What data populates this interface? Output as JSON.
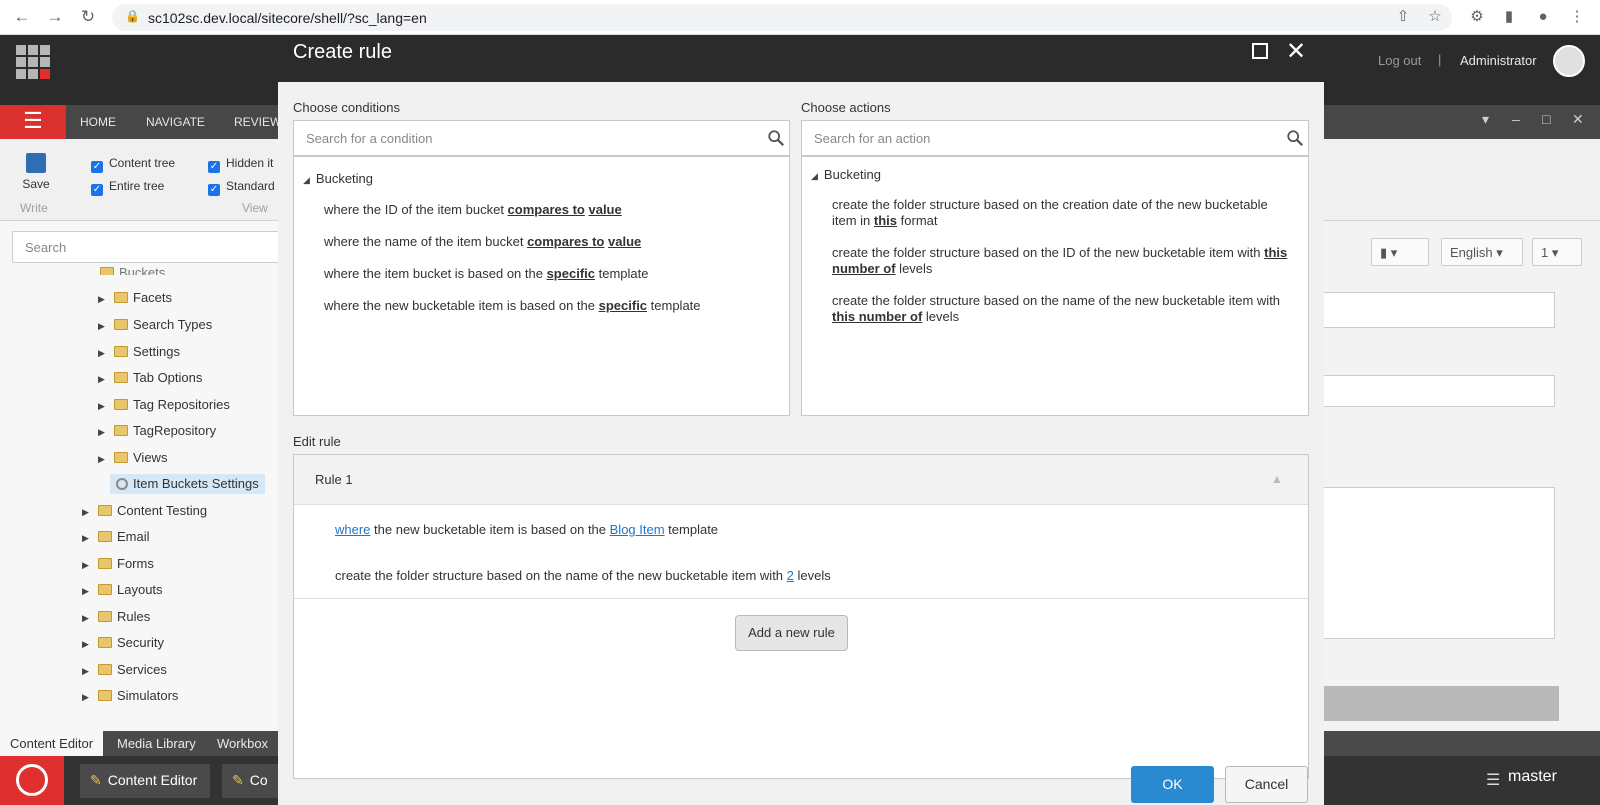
{
  "browser": {
    "url": "sc102sc.dev.local/sitecore/shell/?sc_lang=en"
  },
  "header": {
    "logout": "Log out",
    "separator": "|",
    "user": "Administrator"
  },
  "ribbon": {
    "tabs": [
      "HOME",
      "NAVIGATE",
      "REVIEW"
    ],
    "save_label": "Save",
    "write_group": "Write",
    "view_group": "View",
    "checkboxes": [
      "Content tree",
      "Entire tree",
      "Hidden it",
      "Standard"
    ]
  },
  "tree": {
    "search_placeholder": "Search",
    "partial_top": "Buckets",
    "items": [
      {
        "label": "Facets",
        "level": 2
      },
      {
        "label": "Search Types",
        "level": 2
      },
      {
        "label": "Settings",
        "level": 2
      },
      {
        "label": "Tab Options",
        "level": 2
      },
      {
        "label": "Tag Repositories",
        "level": 2
      },
      {
        "label": "TagRepository",
        "level": 2
      },
      {
        "label": "Views",
        "level": 2
      },
      {
        "label": "Item Buckets Settings",
        "level": 2,
        "selected": true
      },
      {
        "label": "Content Testing",
        "level": 1
      },
      {
        "label": "Email",
        "level": 1
      },
      {
        "label": "Forms",
        "level": 1
      },
      {
        "label": "Layouts",
        "level": 1
      },
      {
        "label": "Rules",
        "level": 1
      },
      {
        "label": "Security",
        "level": 1
      },
      {
        "label": "Services",
        "level": 1
      },
      {
        "label": "Simulators",
        "level": 1
      }
    ]
  },
  "bottom_tabs": [
    "Content Editor",
    "Media Library",
    "Workbox"
  ],
  "taskbar": {
    "tasks": [
      "Content Editor",
      "Co"
    ],
    "database": "master"
  },
  "right_pane": {
    "language": "English",
    "version": "1"
  },
  "dialog": {
    "title": "Create rule",
    "conditions": {
      "label": "Choose conditions",
      "search_placeholder": "Search for a condition",
      "group": "Bucketing",
      "items": [
        [
          {
            "t": "where the ID of the item bucket "
          },
          {
            "k": "compares to"
          },
          {
            "t": " "
          },
          {
            "k": "value"
          }
        ],
        [
          {
            "t": "where the name of the item bucket "
          },
          {
            "k": "compares to"
          },
          {
            "t": " "
          },
          {
            "k": "value"
          }
        ],
        [
          {
            "t": "where the item bucket is based on the "
          },
          {
            "k": "specific"
          },
          {
            "t": " template"
          }
        ],
        [
          {
            "t": "where the new bucketable item is based on the "
          },
          {
            "k": "specific"
          },
          {
            "t": " template"
          }
        ]
      ]
    },
    "actions": {
      "label": "Choose actions",
      "search_placeholder": "Search for an action",
      "group": "Bucketing",
      "items": [
        [
          {
            "t": "create the folder structure based on the creation date of the new bucketable item in "
          },
          {
            "k": "this"
          },
          {
            "t": " format"
          }
        ],
        [
          {
            "t": "create the folder structure based on the ID of the new bucketable item with "
          },
          {
            "k": "this number of"
          },
          {
            "t": " levels"
          }
        ],
        [
          {
            "t": "create the folder structure based on the name of the new bucketable item with "
          },
          {
            "k": "this number of"
          },
          {
            "t": " levels"
          }
        ]
      ]
    },
    "edit_rule": {
      "label": "Edit rule",
      "rule_title": "Rule 1",
      "line1": {
        "link1": "where",
        "mid": " the new bucketable item is based on the ",
        "link2": "Blog Item",
        "end": " template"
      },
      "line2": {
        "start": "create the folder structure based on the name of the new bucketable item with ",
        "link": "2",
        "end": " levels"
      },
      "add_button": "Add a new rule"
    },
    "ok": "OK",
    "cancel": "Cancel"
  }
}
